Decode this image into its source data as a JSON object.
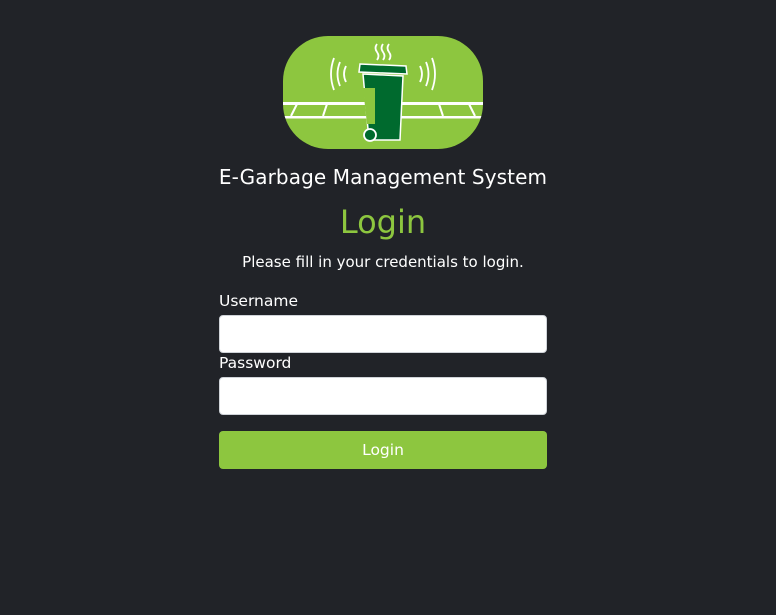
{
  "header": {
    "logo_icon": "garbage-bin-logo-icon",
    "app_title": "E-Garbage Management System"
  },
  "form": {
    "title": "Login",
    "subtitle": "Please fill in your credentials to login.",
    "username_label": "Username",
    "username_value": "",
    "password_label": "Password",
    "password_value": "",
    "submit_label": "Login"
  },
  "colors": {
    "background": "#212328",
    "accent": "#8dc63f",
    "logo_dark_green": "#006a2e"
  }
}
